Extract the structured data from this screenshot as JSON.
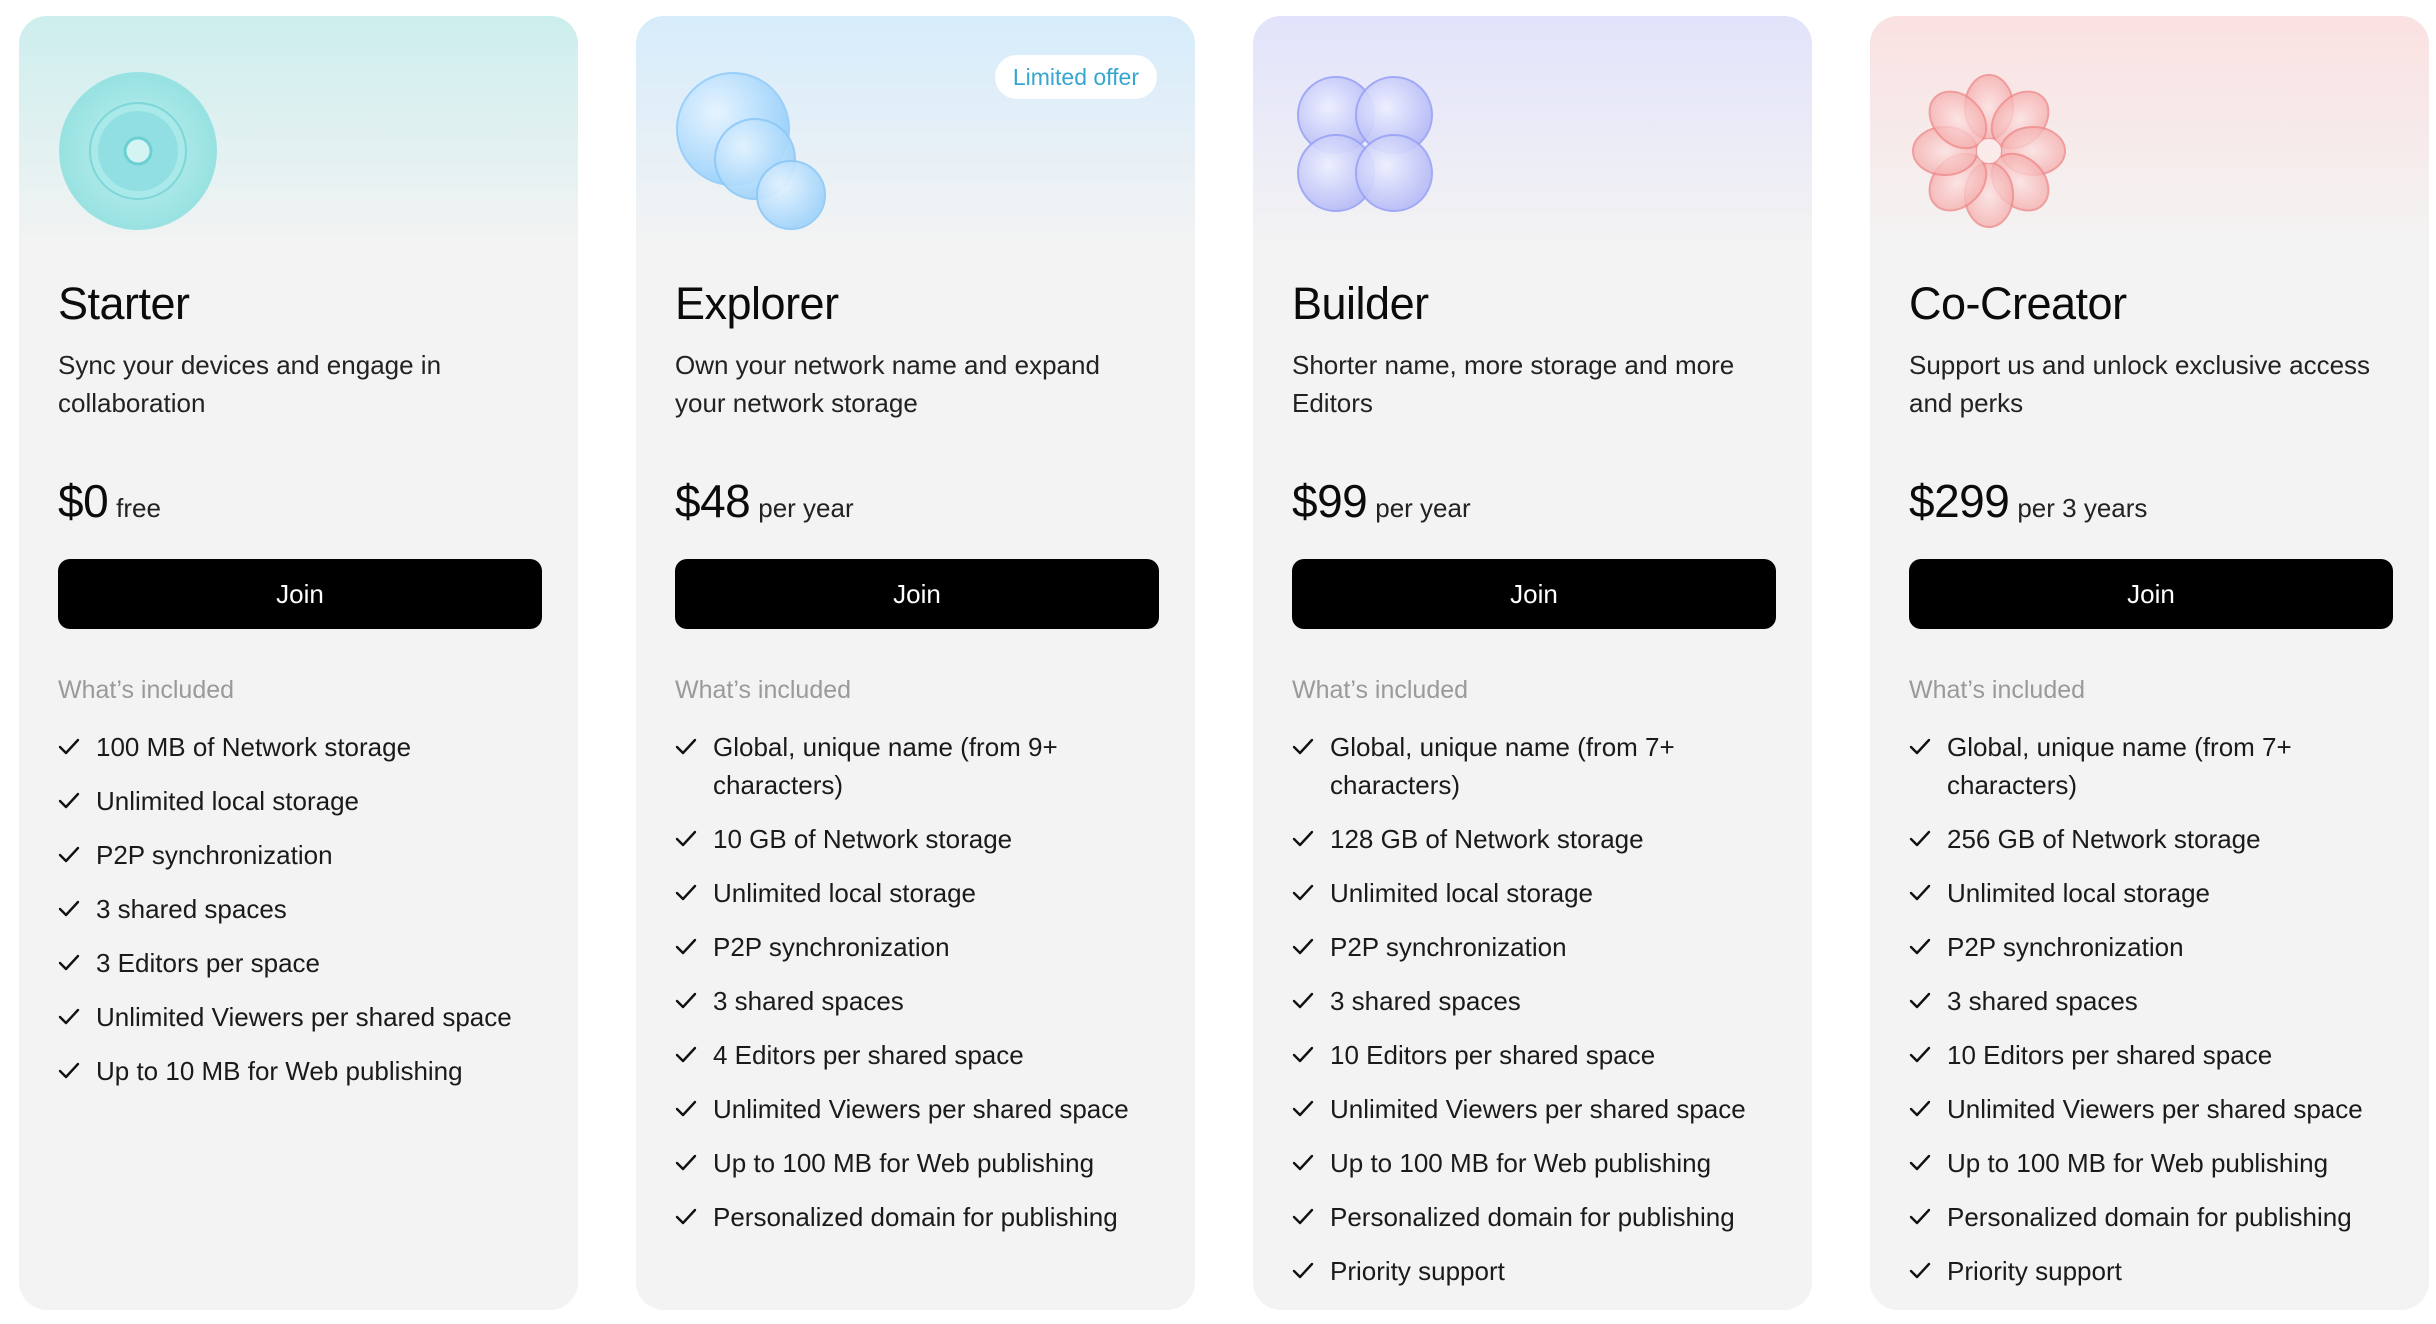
{
  "plans": [
    {
      "name": "Starter",
      "description": "Sync your devices and engage in collaboration",
      "price": "$0",
      "period": "free",
      "button_label": "Join",
      "included_label": "What’s included",
      "accent": "#5fd0d0",
      "logo_icon": "concentric-circles-icon",
      "features": [
        "100 MB of Network storage",
        "Unlimited local storage",
        "P2P synchronization",
        "3 shared spaces",
        "3 Editors per space",
        "Unlimited Viewers per shared space",
        "Up to 10 MB for Web publishing"
      ]
    },
    {
      "name": "Explorer",
      "badge": "Limited offer",
      "description": "Own your network name and expand your network storage",
      "price": "$48",
      "period": "per year",
      "button_label": "Join",
      "included_label": "What’s included",
      "accent": "#7cc4f5",
      "logo_icon": "overlapping-bubbles-icon",
      "features": [
        "Global, unique name (from 9+ characters)",
        "10 GB of Network storage",
        "Unlimited local storage",
        "P2P synchronization",
        "3 shared spaces",
        "4 Editors per shared space",
        "Unlimited Viewers per shared space",
        "Up to 100 MB for Web publishing",
        "Personalized domain for publishing"
      ]
    },
    {
      "name": "Builder",
      "description": "Shorter name, more storage and more Editors",
      "price": "$99",
      "period": "per year",
      "button_label": "Join",
      "included_label": "What’s included",
      "accent": "#9aa2f5",
      "logo_icon": "four-circles-icon",
      "features": [
        "Global, unique name (from 7+ characters)",
        "128 GB of Network storage",
        "Unlimited local storage",
        "P2P synchronization",
        "3 shared spaces",
        "10 Editors per shared space",
        "Unlimited Viewers per shared space",
        "Up to 100 MB for Web publishing",
        "Personalized domain for publishing",
        "Priority support"
      ]
    },
    {
      "name": "Co-Creator",
      "description": "Support us and unlock exclusive access and perks",
      "price": "$299",
      "period": "per 3 years",
      "button_label": "Join",
      "included_label": "What’s included",
      "accent": "#f08a8a",
      "logo_icon": "flower-icon",
      "features": [
        "Global, unique name (from 7+ characters)",
        "256 GB of Network storage",
        "Unlimited local storage",
        "P2P synchronization",
        "3 shared spaces",
        "10 Editors per shared space",
        "Unlimited Viewers per shared space",
        "Up to 100 MB for Web publishing",
        "Personalized domain for publishing",
        "Priority support"
      ]
    }
  ]
}
